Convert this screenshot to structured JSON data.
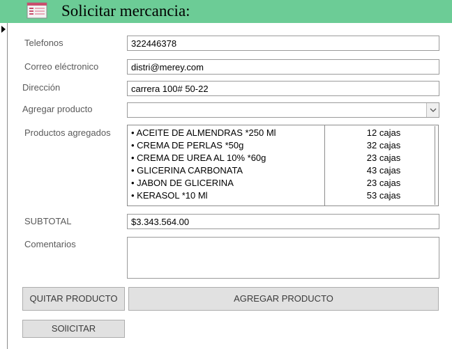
{
  "form": {
    "title": "Solicitar mercancia:",
    "icon": "form-icon"
  },
  "fields": {
    "telefonos_label": "Telefonos",
    "telefonos_value": "322446378",
    "correo_label": "Correo eléctronico",
    "correo_value": "distri@merey.com",
    "direccion_label": "Dirección",
    "direccion_value": "carrera 100# 50-22",
    "agregar_label": "Agregar producto",
    "agregar_value": "",
    "productos_label": "Productos agregados",
    "subtotal_label": "SUBTOTAL",
    "subtotal_value": "$3.343.564.00",
    "comentarios_label": "Comentarios",
    "comentarios_value": ""
  },
  "productos": [
    {
      "name": "• ACEITE DE ALMENDRAS *250 Ml",
      "qty": "12 cajas"
    },
    {
      "name": "• CREMA DE PERLAS *50g",
      "qty": "32 cajas"
    },
    {
      "name": "• CREMA DE UREA AL 10% *60g",
      "qty": "23 cajas"
    },
    {
      "name": "• GLICERINA CARBONATA",
      "qty": "43 cajas"
    },
    {
      "name": "• JABON DE GLICERINA",
      "qty": "23 cajas"
    },
    {
      "name": "• KERASOL *10 Ml",
      "qty": "53 cajas"
    }
  ],
  "buttons": {
    "quitar": "QUITAR PRODUCTO",
    "agregar": "AGREGAR PRODUCTO",
    "solicitar": "SOlICITAR"
  },
  "colors": {
    "titlebar": "#6ccc96",
    "button_face": "#e1e1e1"
  }
}
